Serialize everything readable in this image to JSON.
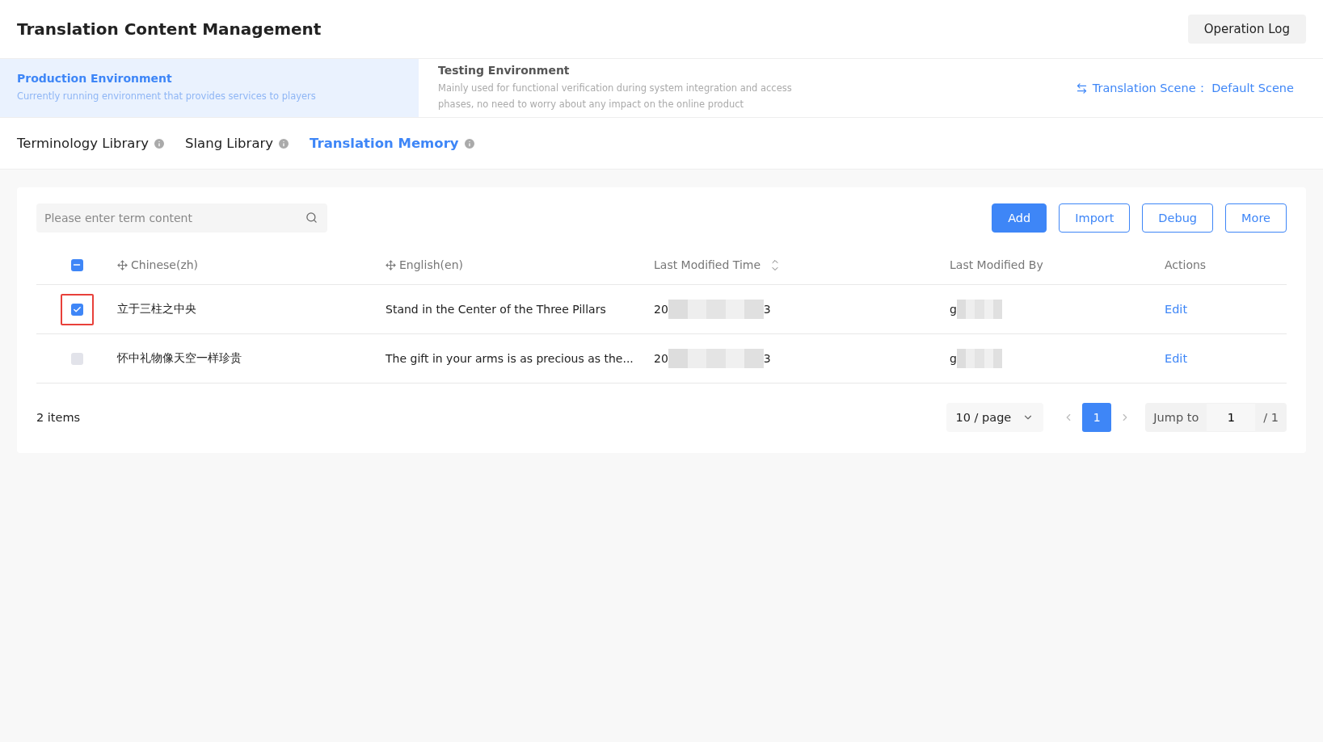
{
  "header": {
    "title": "Translation Content Management",
    "button": "Operation Log"
  },
  "environments": [
    {
      "title": "Production Environment",
      "description": "Currently running environment that provides services to players",
      "selected": true
    },
    {
      "title": "Testing Environment",
      "description": "Mainly used for functional verification during system integration and access phases, no need to worry about any impact on the online product",
      "selected": false
    }
  ],
  "scene": {
    "label": "Translation Scene：",
    "value": "Default Scene"
  },
  "tabs": [
    {
      "label": "Terminology Library",
      "selected": false
    },
    {
      "label": "Slang Library",
      "selected": false
    },
    {
      "label": "Translation Memory",
      "selected": true
    }
  ],
  "search": {
    "placeholder": "Please enter term content"
  },
  "actions": [
    {
      "label": "Add",
      "kind": "primary"
    },
    {
      "label": "Import",
      "kind": "outline"
    },
    {
      "label": "Debug",
      "kind": "outline"
    },
    {
      "label": "More",
      "kind": "outline"
    }
  ],
  "table": {
    "select_all": {
      "checked": true,
      "partial": true
    },
    "columns": [
      {
        "label": "Chinese(zh)",
        "kind": "drag"
      },
      {
        "label": "English(en)",
        "kind": "drag"
      },
      {
        "label": "Last Modified Time",
        "kind": "sort"
      },
      {
        "label": "Last Modified By",
        "kind": "plain"
      },
      {
        "label": "Actions",
        "kind": "plain"
      }
    ],
    "rows": [
      {
        "checked": true,
        "highlighted": true,
        "zh": "立于三柱之中央",
        "en": "Stand in the Center of the Three Pillars",
        "time_start": "20",
        "time_end": "3",
        "modified_by": "g",
        "action": "Edit"
      },
      {
        "checked": false,
        "highlighted": false,
        "zh": "怀中礼物像天空一样珍贵",
        "en": "The gift in your arms is as precious as the...",
        "time_start": "20",
        "time_end": "3",
        "modified_by": "g",
        "action": "Edit"
      }
    ]
  },
  "pagination": {
    "total": "2 items",
    "page_size": "10 / page",
    "pages": [
      {
        "label": "1",
        "selected": true
      }
    ],
    "jump_label": "Jump to",
    "jump_value": "1",
    "page_count": "/ 1"
  }
}
